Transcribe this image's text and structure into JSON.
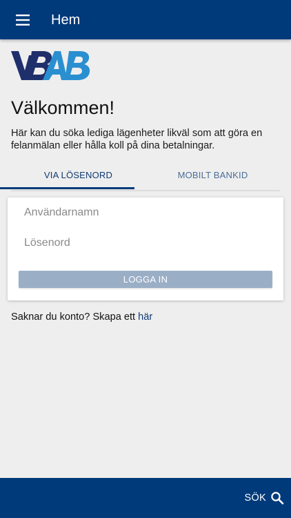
{
  "header": {
    "title": "Hem",
    "menu_icon": "hamburger-menu-icon"
  },
  "brand": {
    "logo_text": "VBAB",
    "colors": {
      "dark": "#1f2f6b",
      "light": "#2a8fd0"
    }
  },
  "main": {
    "welcome": "Välkommen!",
    "intro": "Här kan du söka lediga lägenheter likväl som att göra en felanmälan eller hålla koll på dina betalningar.",
    "tabs": [
      {
        "label": "VIA LÖSENORD",
        "active": true
      },
      {
        "label": "MOBILT BANKID",
        "active": false
      }
    ],
    "login": {
      "username_placeholder": "Användarnamn",
      "password_placeholder": "Lösenord",
      "submit_label": "LOGGA IN"
    },
    "signup": {
      "text": "Saknar du konto? Skapa ett ",
      "link_label": "här"
    }
  },
  "footer": {
    "search_label": "SÖK",
    "search_icon": "magnifier-icon"
  },
  "colors": {
    "primary": "#003a7a",
    "background": "#eeeeee",
    "button_disabled": "#9aaec6",
    "tab_active_text": "#0f3a73",
    "tab_inactive_text": "#4b6d97"
  }
}
